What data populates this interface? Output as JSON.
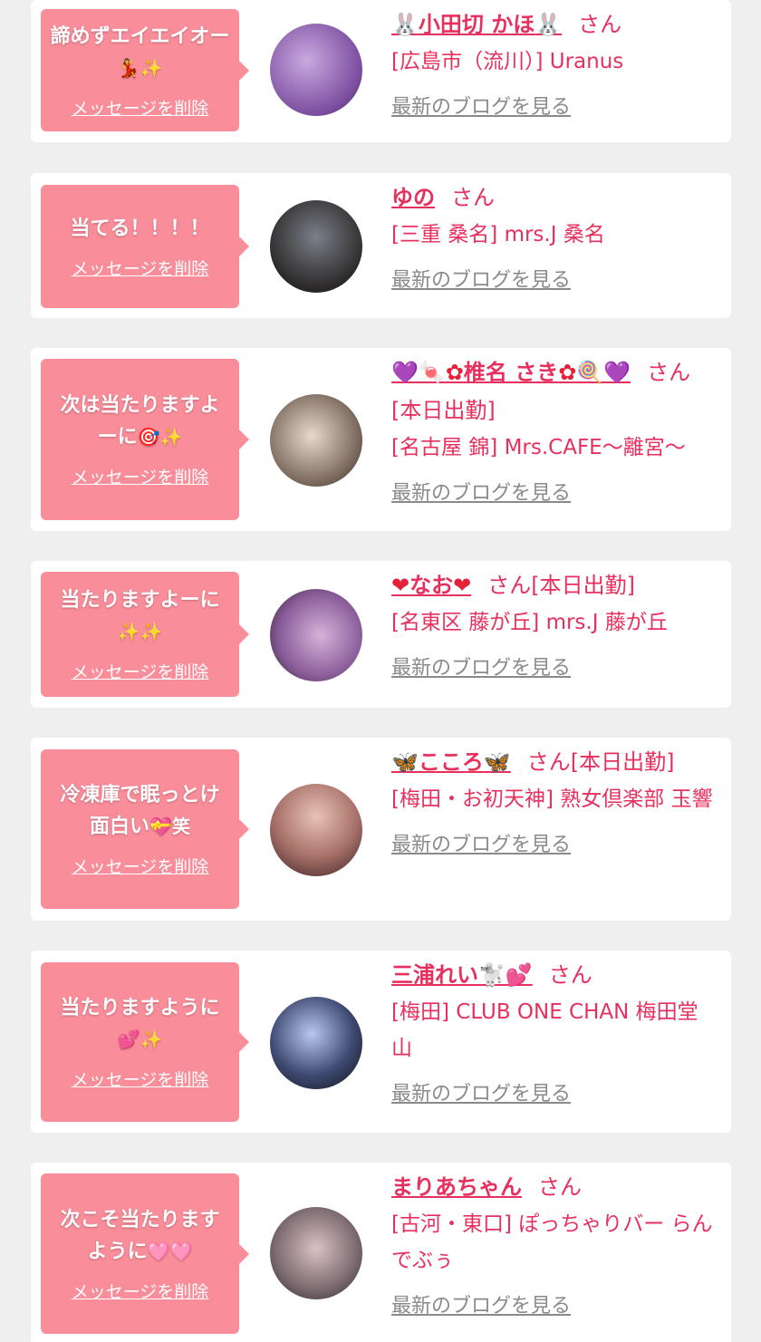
{
  "delete_label": "メッセージを削除",
  "blog_label": "最新のブログを見る",
  "san_label": "さん",
  "items": [
    {
      "message": "諦めずエイエイオー",
      "deco": "💃✨",
      "name": "小田切 かほ",
      "suffix": "",
      "shop": "[広島市（流川）] Uranus"
    },
    {
      "message": "当てる！！！！",
      "deco": "",
      "name": "ゆの",
      "suffix": "",
      "shop": "[三重 桑名] mrs.J 桑名"
    },
    {
      "message": "次は当たりますよーに",
      "deco": "🎯✨",
      "name": "椎名 さき",
      "suffix": "[本日出勤]",
      "shop": "[名古屋 錦] Mrs.CAFE〜離宮〜"
    },
    {
      "message": "当たりますよーに",
      "deco": "✨✨",
      "name": "なお",
      "suffix": "[本日出勤]",
      "shop": "[名東区 藤が丘] mrs.J 藤が丘"
    },
    {
      "message": "冷凍庫で眠っとけ面白い",
      "deco": "💝笑",
      "name": "こころ",
      "suffix": "[本日出勤]",
      "shop": "[梅田・お初天神] 熟女倶楽部 玉響"
    },
    {
      "message": "当たりますように",
      "deco": "💕✨",
      "name": "三浦れい",
      "suffix": "",
      "shop": "[梅田] CLUB ONE CHAN 梅田堂山"
    },
    {
      "message": "次こそ当たりますように",
      "deco": "🩷🩷",
      "name": "まりあちゃん",
      "suffix": "",
      "shop": "[古河・東口] ぽっちゃりバー らんでぶぅ"
    }
  ],
  "colors": {
    "bubble": "#f98d99",
    "accent": "#e8305e",
    "link_gray": "#8a8a8a",
    "background": "#efefef"
  }
}
